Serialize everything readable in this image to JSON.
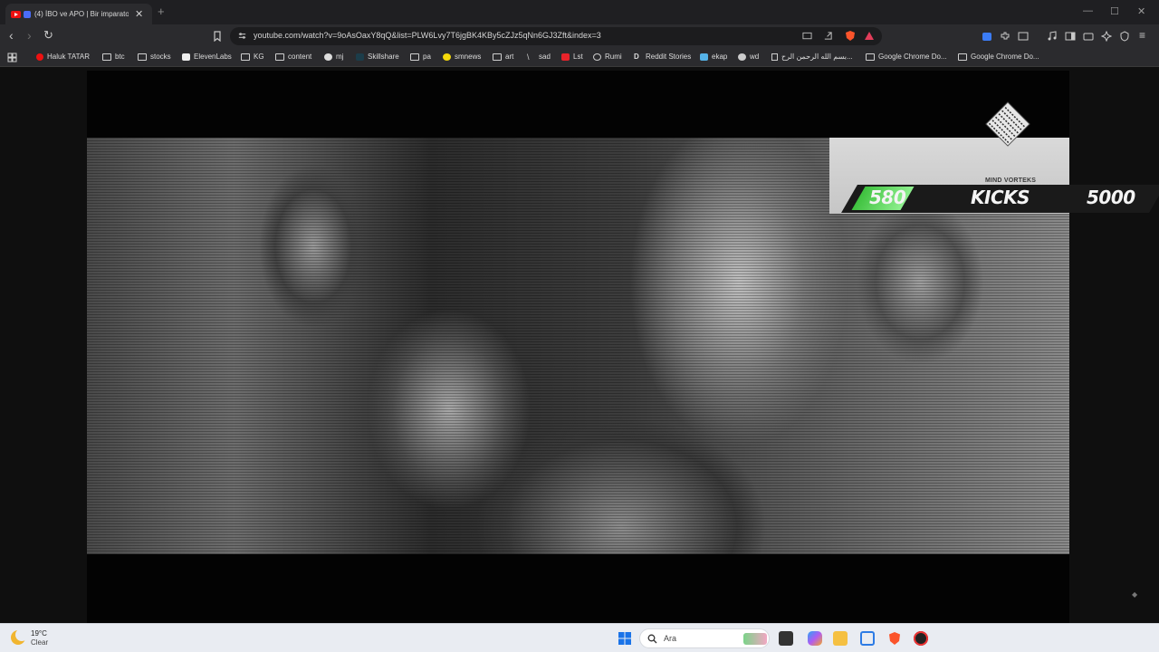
{
  "browser": {
    "tab_title": "(4) İBO ve APO | Bir imparator",
    "url": "youtube.com/watch?v=9oAsOaxY8qQ&list=PLW6Lvy7T6jgBK4KBy5cZJz5qNn6GJ3Zft&index=3"
  },
  "bookmarks": [
    {
      "label": "Haluk TATAR",
      "icon": "youtube-icon"
    },
    {
      "label": "btc",
      "icon": "folder-icon"
    },
    {
      "label": "stocks",
      "icon": "folder-icon"
    },
    {
      "label": "ElevenLabs",
      "icon": "elevenlabs-icon"
    },
    {
      "label": "KG",
      "icon": "folder-icon"
    },
    {
      "label": "content",
      "icon": "folder-icon"
    },
    {
      "label": "mj",
      "icon": "github-icon"
    },
    {
      "label": "Skillshare",
      "icon": "skillshare-icon"
    },
    {
      "label": "pa",
      "icon": "folder-icon"
    },
    {
      "label": "smnews",
      "icon": "smiley-icon"
    },
    {
      "label": "art",
      "icon": "folder-icon"
    },
    {
      "label": "sad",
      "icon": "v-icon"
    },
    {
      "label": "Lst",
      "icon": "s-icon"
    },
    {
      "label": "Rumi",
      "icon": "globe-icon"
    },
    {
      "label": "Reddit Stories",
      "icon": "d-icon"
    },
    {
      "label": "ekap",
      "icon": "bird-icon"
    },
    {
      "label": "wd",
      "icon": "w-icon"
    },
    {
      "label": "بسم الله الرحمن الرح...",
      "icon": "page-icon"
    },
    {
      "label": "Google Chrome Do...",
      "icon": "folder-icon"
    },
    {
      "label": "Google Chrome Do...",
      "icon": "folder-icon"
    }
  ],
  "video": {
    "brand": "MIND VORTEKS",
    "kicks_count": "580",
    "kicks_label": "KICKS",
    "kicks_goal": "5000"
  },
  "taskbar": {
    "temperature": "19°C",
    "condition": "Clear",
    "search_placeholder": "Ara"
  },
  "colors": {
    "kicks_green": "#3ec13e",
    "youtube_red": "#e11111"
  }
}
